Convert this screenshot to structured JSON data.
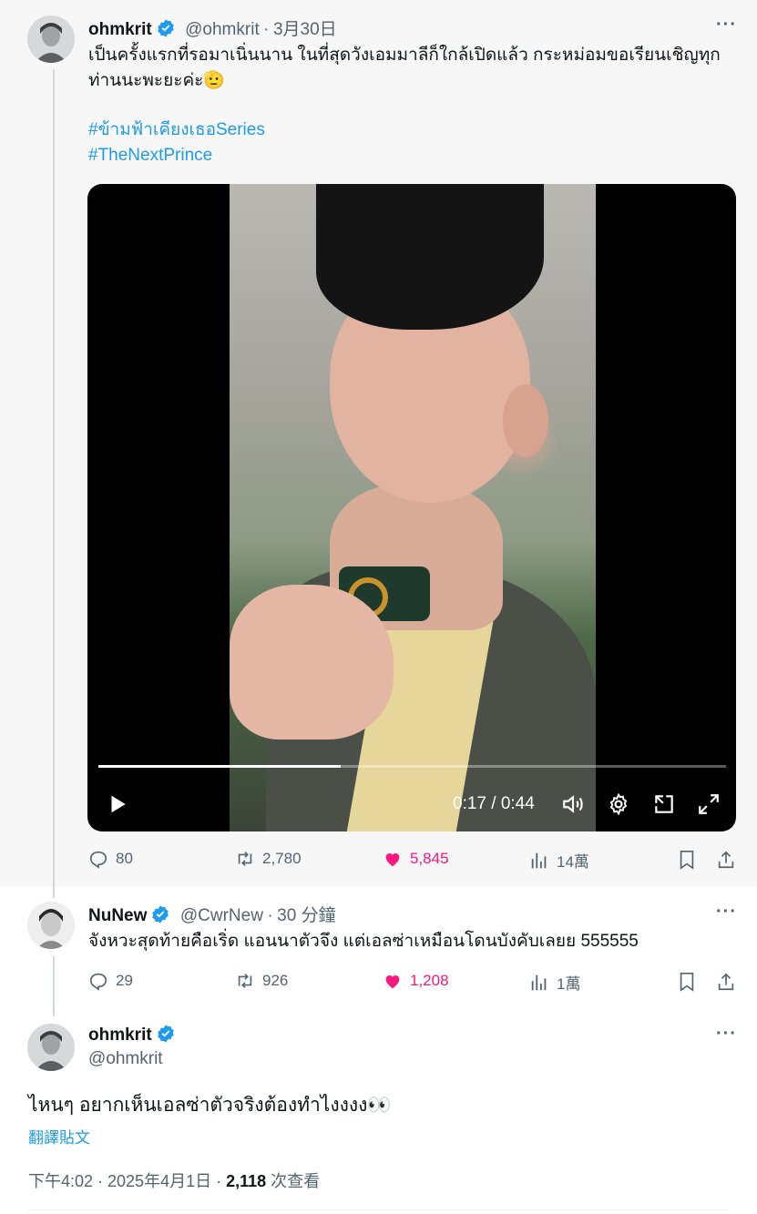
{
  "tweet1": {
    "author_name": "ohmkrit",
    "author_handle": "@ohmkrit",
    "separator": "·",
    "date": "3月30日",
    "text_line1": "เป็นครั้งแรกที่รอมาเนิ่นนาน ในที่สุดวังเอมมาลีก็ใกล้เปิดแล้ว กระหม่อมขอเรียนเชิญทุก",
    "text_line2": "ท่านนะพะยะค่ะ🫡",
    "hashtags": [
      "#ข้ามฟ้าเคียงเธอSeries",
      "#TheNextPrince"
    ],
    "video": {
      "time": "0:17 / 0:44",
      "progress_fraction": 0.386
    },
    "actions": {
      "replies": "80",
      "retweets": "2,780",
      "likes": "5,845",
      "views": "14萬"
    }
  },
  "tweet2": {
    "author_name": "NuNew",
    "author_handle": "@CwrNew",
    "separator": "·",
    "time": "30 分鐘",
    "text": "จังหวะสุดท้ายคือเริ่ด แอนนาตัวจึง แต่เอลซ่าเหมือนโดนบังคับเลยย 555555",
    "actions": {
      "replies": "29",
      "retweets": "926",
      "likes": "1,208",
      "views": "1萬"
    }
  },
  "tweet3": {
    "author_name": "ohmkrit",
    "author_handle": "@ohmkrit",
    "text": "ไหนๆ อยากเห็นเอลซ่าตัวจริงต้องทำไงงงง👀",
    "translate_label": "翻譯貼文",
    "timestamp": "下午4:02 · 2025年4月1日 · ",
    "view_count": "2,118",
    "view_label": " 次查看"
  },
  "more_label": "···",
  "colors": {
    "accent": "#1d9bf0",
    "like": "#f91880",
    "secondary_text": "#536471"
  }
}
